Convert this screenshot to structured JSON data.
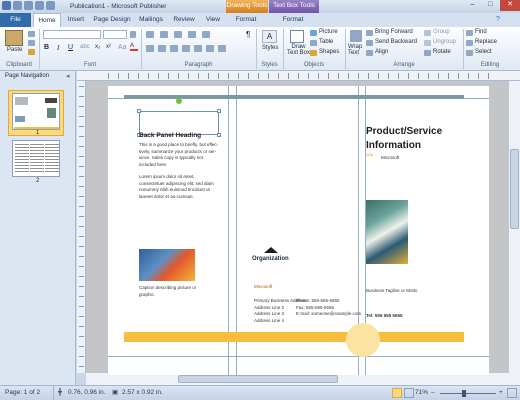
{
  "window": {
    "title": "Publication1 - Microsoft Publisher"
  },
  "context_tabs": {
    "drawing": "Drawing Tools",
    "textbox": "Text Box Tools"
  },
  "tabs": [
    "File",
    "Home",
    "Insert",
    "Page Design",
    "Mailings",
    "Review",
    "View",
    "Format",
    "Format"
  ],
  "ribbon": {
    "groups": [
      "Clipboard",
      "Font",
      "Paragraph",
      "Styles",
      "Objects",
      "Arrange",
      "Editing"
    ],
    "paste": "Paste",
    "styles": "Styles",
    "draw_text_box": [
      "Draw",
      "Text Box"
    ],
    "picture": "Picture",
    "table": "Table",
    "shapes": "Shapes",
    "wrap_text": [
      "Wrap",
      "Text"
    ],
    "bring_forward": "Bring Forward",
    "send_backward": "Send Backward",
    "align": "Align",
    "group": "Group",
    "ungroup": "Ungroup",
    "rotate": "Rotate",
    "find": "Find",
    "replace": "Replace",
    "select": "Select"
  },
  "nav": {
    "title": "Page Navigation",
    "pages": [
      "1",
      "2"
    ]
  },
  "doc": {
    "back_heading": "Back Panel Heading",
    "back_body1": "This is a good place to briefly, but effec-tively, summarize your products or ser-vices. Sales copy is typically not included here.",
    "back_body2": "Lorem ipsum dolor sit amet, consectetuer adipiscing elit, sed diam nonummy nibh euismod tincidunt ut laoreet dolor et au-cumsan.",
    "caption": "Caption describing picture or graphic.",
    "org": "Organization",
    "ms": "Microsoft",
    "addr": [
      "Primary Business Address",
      "Address Line 2",
      "Address Line 3",
      "Address Line 4"
    ],
    "contact": [
      "Phone: 555-555-5555",
      "Fax: 555-555-5555",
      "E-mail: someone@example.com"
    ],
    "title1": "Product/Service",
    "title2": "Information",
    "chev": ">>",
    "ms2": "Microsoft",
    "tagline": "Business Tagline or Motto",
    "tel": "Tel: 555 555 5555"
  },
  "status": {
    "page": "Page: 1 of 2",
    "pos": "0.76, 0.96 in.",
    "size": "2.57 x 0.92 in.",
    "zoom": "71%"
  },
  "colors": {
    "accent_yellow": "#f6be3c",
    "guide_teal": "#7a9aa0",
    "file_tab": "#2f6ca8"
  }
}
